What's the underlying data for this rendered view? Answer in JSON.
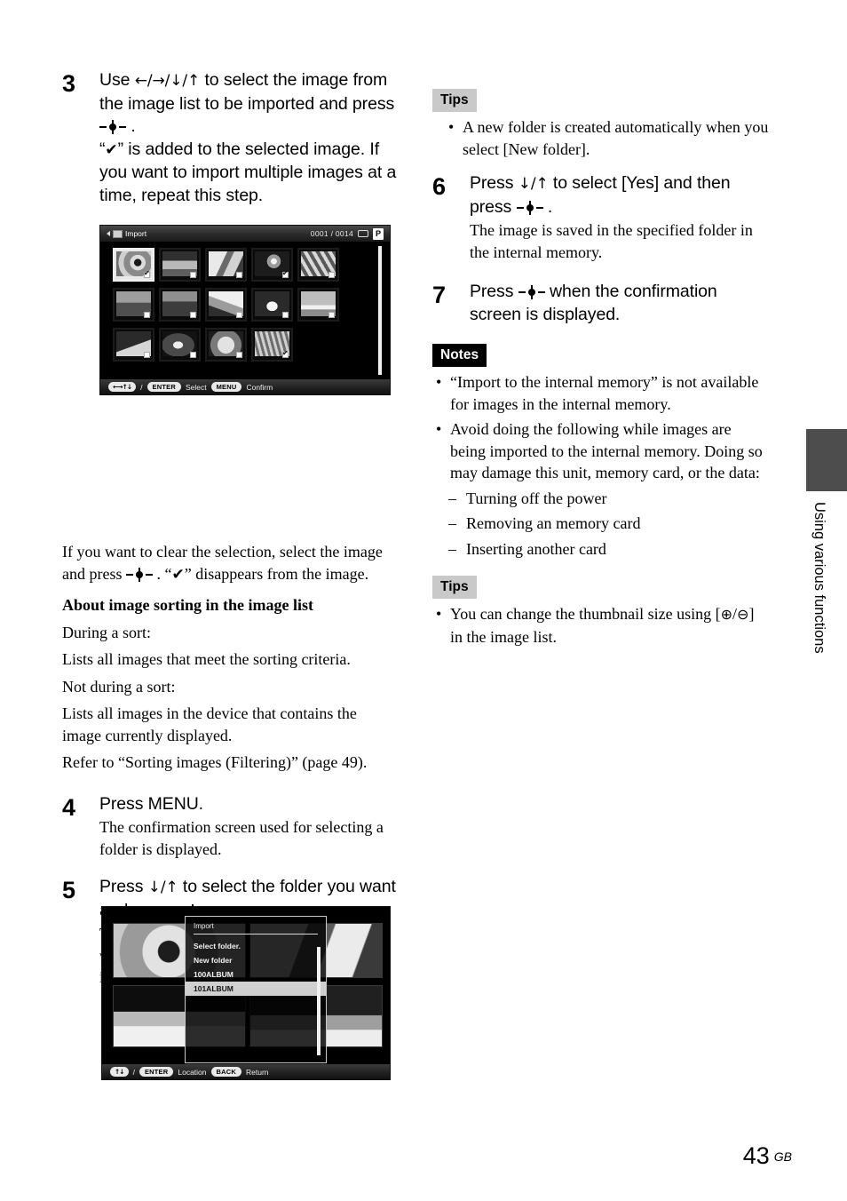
{
  "page": {
    "number": "43",
    "region_code": "GB",
    "side_tab_label": "Using various functions"
  },
  "left_column": {
    "step3": {
      "number": "3",
      "title_part1": "Use ",
      "title_arrows": "←/→/↓/↑",
      "title_part2": " to select the image from the image list to be imported and press ",
      "title_part3": " .",
      "desc_line1_pre": "“",
      "desc_check": "✔",
      "desc_line1_post": "” is added to the selected image. If you want to import multiple images at a time, repeat this step."
    },
    "after_shot": {
      "line1_a": "If you want to clear the selection, select the image and press ",
      "line1_b": " . “",
      "line1_check": "✔",
      "line1_c": "” disappears from the image.",
      "heading": "About image sorting in the image list",
      "p1": "During a sort:",
      "p2": "Lists all images that meet the sorting criteria.",
      "p3": "Not during a sort:",
      "p4": "Lists all images in the device that contains the image currently displayed.",
      "p5": "Refer to “Sorting images (Filtering)” (page 49)."
    },
    "step4": {
      "number": "4",
      "title": "Press MENU.",
      "desc": "The confirmation screen used for selecting a folder is displayed."
    },
    "step5": {
      "number": "5",
      "title_part1": "Press ",
      "title_arrows": "↓/↑",
      "title_part2": " to select the folder you want and press ",
      "title_part3": " .",
      "desc": "The confirmation screen used to decide whether to import an image or not to the internal memory is displayed."
    }
  },
  "right_column": {
    "tips_top": {
      "label": "Tips",
      "items": [
        "A new folder is created automatically when you select [New folder]."
      ]
    },
    "step6": {
      "number": "6",
      "title_part1": "Press ",
      "title_arrows": "↓/↑",
      "title_part2": " to select [Yes] and then press ",
      "title_part3": " .",
      "desc": "The image is saved in the specified folder in the internal memory."
    },
    "step7": {
      "number": "7",
      "title_part1": "Press ",
      "title_part2": " when the confirmation screen is displayed."
    },
    "notes": {
      "label": "Notes",
      "items": [
        "“Import to the internal memory” is not available for images in the internal memory.",
        "Avoid doing the following while images are being imported to the internal memory. Doing so may damage this unit, memory card, or the data:"
      ],
      "sub_items": [
        "Turning off the power",
        "Removing an memory card",
        "Inserting another card"
      ]
    },
    "tips_bottom": {
      "label": "Tips",
      "item_pre": "You can change the thumbnail size using [",
      "item_zoom_in": "⊕",
      "item_slash": "/",
      "item_zoom_out": "⊖",
      "item_post": "] in the image list."
    }
  },
  "screenshot_import": {
    "title": "Import",
    "counter": "0001 / 0014",
    "p_badge": "P",
    "footer": {
      "arrows": "←→↑↓",
      "slash": "/",
      "enter_key": "ENTER",
      "enter_action": "Select",
      "menu_key": "MENU",
      "menu_action": "Confirm"
    },
    "rows": [
      [
        {
          "name": "sunflower",
          "selected": true,
          "checked": true
        },
        {
          "name": "cathedral",
          "selected": false,
          "checked": false
        },
        {
          "name": "laundry",
          "selected": false,
          "checked": false
        },
        {
          "name": "clocks",
          "selected": false,
          "checked": true
        },
        {
          "name": "taxis",
          "selected": false,
          "checked": false
        }
      ],
      [
        {
          "name": "field",
          "selected": false,
          "checked": false
        },
        {
          "name": "flowers",
          "selected": false,
          "checked": false
        },
        {
          "name": "heron",
          "selected": false,
          "checked": false
        },
        {
          "name": "swan",
          "selected": false,
          "checked": false
        },
        {
          "name": "beach-bird",
          "selected": false,
          "checked": false
        }
      ],
      [
        {
          "name": "skiers",
          "selected": false,
          "checked": false
        },
        {
          "name": "night-road",
          "selected": false,
          "checked": false
        },
        {
          "name": "girl",
          "selected": false,
          "checked": false
        },
        {
          "name": "lavender",
          "selected": false,
          "checked": true
        }
      ]
    ]
  },
  "screenshot_folder": {
    "dialog_title": "Import",
    "items": [
      {
        "label": "Select folder.",
        "selected": false
      },
      {
        "label": "New folder",
        "selected": false
      },
      {
        "label": "100ALBUM",
        "selected": false
      },
      {
        "label": "101ALBUM",
        "selected": true
      }
    ],
    "footer": {
      "arrows": "↑↓",
      "slash": "/",
      "enter_key": "ENTER",
      "enter_action": "Location",
      "back_key": "BACK",
      "back_action": "Return"
    }
  }
}
